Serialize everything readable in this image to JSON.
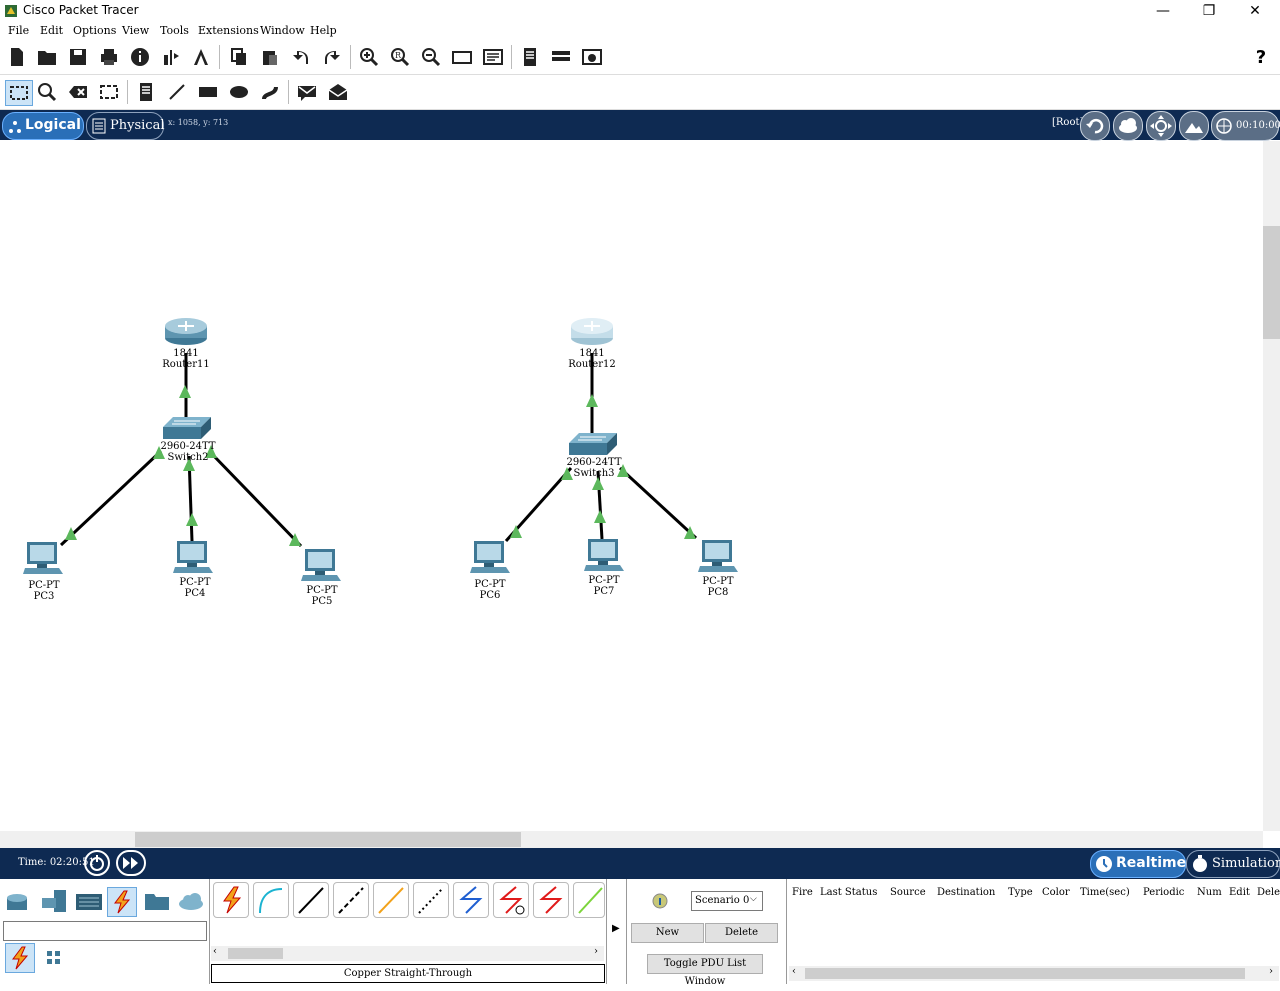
{
  "window": {
    "title": "Cisco Packet Tracer",
    "min": "—",
    "restore": "❐",
    "close": "✕"
  },
  "menu": [
    "File",
    "Edit",
    "Options",
    "View",
    "Tools",
    "Extensions",
    "Window",
    "Help"
  ],
  "help_icon": "?",
  "nav": {
    "logical": "Logical",
    "physical": "Physical",
    "coords": "x: 1058, y: 713",
    "root": "[Root]",
    "clock": "00:10:00"
  },
  "devices": [
    {
      "model": "1841",
      "name": "Router11"
    },
    {
      "model": "2960-24TT",
      "name": "Switch2"
    },
    {
      "model": "PC-PT",
      "name": "PC3"
    },
    {
      "model": "PC-PT",
      "name": "PC4"
    },
    {
      "model": "PC-PT",
      "name": "PC5"
    },
    {
      "model": "1841",
      "name": "Router12"
    },
    {
      "model": "2960-24TT",
      "name": "Switch3"
    },
    {
      "model": "PC-PT",
      "name": "PC6"
    },
    {
      "model": "PC-PT",
      "name": "PC7"
    },
    {
      "model": "PC-PT",
      "name": "PC8"
    }
  ],
  "timebar": {
    "time": "Time: 02:20:51",
    "realtime": "Realtime",
    "simulation": "Simulation"
  },
  "bottom": {
    "cable_label": "Copper Straight-Through",
    "scenario": "Scenario 0",
    "new": "New",
    "delete": "Delete",
    "toggle": "Toggle PDU List Window",
    "pdu_columns": [
      "Fire",
      "Last Status",
      "Source",
      "Destination",
      "Type",
      "Color",
      "Time(sec)",
      "Periodic",
      "Num",
      "Edit",
      "Delete"
    ]
  },
  "colors": {
    "nav": "#0e2a52",
    "link": "#000000",
    "port": "#5cb85c"
  }
}
